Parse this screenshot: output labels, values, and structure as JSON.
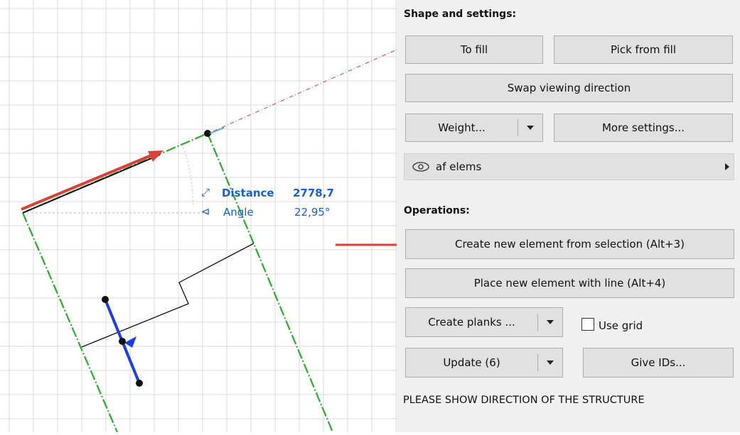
{
  "canvas": {
    "distance_label": "Distance",
    "distance_value": "2778,7",
    "angle_label": "Angle",
    "angle_value": "22,95°"
  },
  "panel": {
    "shape_header": "Shape and settings:",
    "to_fill": "To fill",
    "pick_from_fill": "Pick from fill",
    "swap_direction": "Swap viewing direction",
    "weight": "Weight...",
    "more_settings": "More settings...",
    "layer_name": "af elems",
    "operations_header": "Operations:",
    "create_from_selection": "Create new element from selection (Alt+3)",
    "place_with_line": "Place new element with line (Alt+4)",
    "create_planks": "Create planks ...",
    "use_grid": "Use grid",
    "update": "Update (6)",
    "give_ids": "Give IDs...",
    "status": "PLEASE SHOW DIRECTION OF THE STRUCTURE"
  },
  "icons": [
    "eye-icon",
    "dropdown-arrow-icon",
    "chevron-right-icon",
    "distance-icon",
    "angle-icon",
    "red-arrow-icon"
  ],
  "colors": {
    "grid": "#d9d9d9",
    "green": "#2ea82e",
    "red_arrow": "#d9423a",
    "blue": "#1f3fe0",
    "dim_text": "#1a5fd1"
  }
}
